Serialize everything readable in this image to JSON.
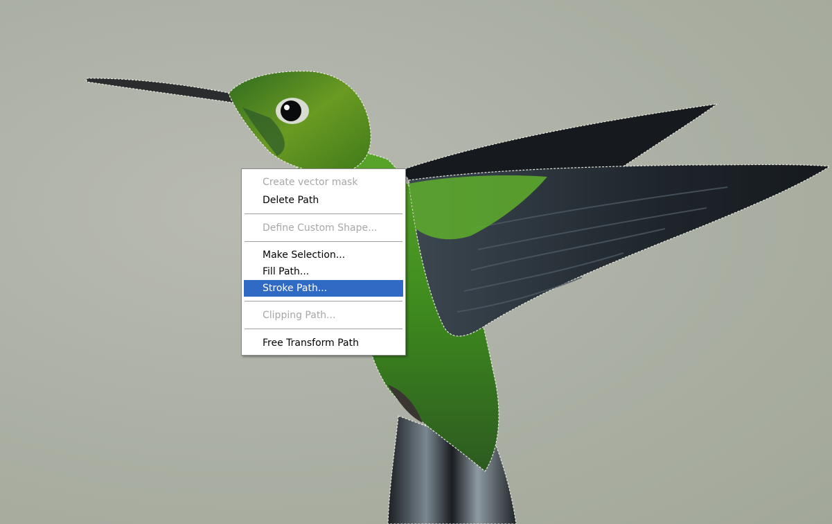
{
  "canvas": {
    "image_subject": "hummingbird-photo",
    "background_color": "#a9ada2"
  },
  "context_menu": {
    "items": [
      {
        "label": "Create vector mask",
        "enabled": false
      },
      {
        "label": "Delete Path",
        "enabled": true
      },
      {
        "label": "Define Custom Shape...",
        "enabled": false
      },
      {
        "label": "Make Selection...",
        "enabled": true
      },
      {
        "label": "Fill Path...",
        "enabled": true
      },
      {
        "label": "Stroke Path...",
        "enabled": true,
        "highlighted": true
      },
      {
        "label": "Clipping Path...",
        "enabled": false
      },
      {
        "label": "Free Transform Path",
        "enabled": true
      }
    ],
    "highlight_color": "#316ac5"
  }
}
